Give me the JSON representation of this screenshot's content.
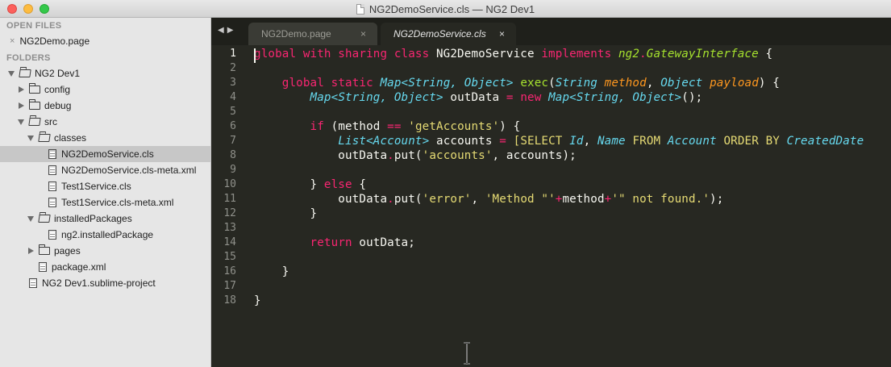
{
  "window": {
    "title": "NG2DemoService.cls — NG2 Dev1"
  },
  "sidebar": {
    "open_files_heading": "OPEN FILES",
    "open_files": [
      {
        "label": "NG2Demo.page",
        "close_symbol": "×"
      }
    ],
    "folders_heading": "FOLDERS",
    "tree": [
      {
        "label": "NG2 Dev1",
        "kind": "folder",
        "state": "open",
        "depth": 0
      },
      {
        "label": "config",
        "kind": "folder",
        "state": "closed",
        "depth": 1
      },
      {
        "label": "debug",
        "kind": "folder",
        "state": "closed",
        "depth": 1
      },
      {
        "label": "src",
        "kind": "folder",
        "state": "open",
        "depth": 1
      },
      {
        "label": "classes",
        "kind": "folder",
        "state": "open",
        "depth": 2
      },
      {
        "label": "NG2DemoService.cls",
        "kind": "file",
        "depth": 3,
        "selected": true
      },
      {
        "label": "NG2DemoService.cls-meta.xml",
        "kind": "file",
        "depth": 3
      },
      {
        "label": "Test1Service.cls",
        "kind": "file",
        "depth": 3
      },
      {
        "label": "Test1Service.cls-meta.xml",
        "kind": "file",
        "depth": 3
      },
      {
        "label": "installedPackages",
        "kind": "folder",
        "state": "open",
        "depth": 2
      },
      {
        "label": "ng2.installedPackage",
        "kind": "file",
        "depth": 3
      },
      {
        "label": "pages",
        "kind": "folder",
        "state": "closed",
        "depth": 2
      },
      {
        "label": "package.xml",
        "kind": "file",
        "depth": 2
      },
      {
        "label": "NG2 Dev1.sublime-project",
        "kind": "file",
        "depth": 1
      }
    ]
  },
  "tabs": {
    "nav_back": "◀",
    "nav_forward": "▶",
    "items": [
      {
        "label": "NG2Demo.page",
        "close_symbol": "×",
        "active": false
      },
      {
        "label": "NG2DemoService.cls",
        "close_symbol": "×",
        "active": true
      }
    ]
  },
  "editor": {
    "current_line": 1,
    "lines": [
      [
        [
          "kw",
          "global with sharing class "
        ],
        [
          "plain",
          "NG2DemoService "
        ],
        [
          "kw",
          "implements "
        ],
        [
          "iface",
          "ng2"
        ],
        [
          "kw",
          "."
        ],
        [
          "iface",
          "GatewayInterface"
        ],
        [
          "plain",
          " {"
        ]
      ],
      [],
      [
        [
          "plain",
          "    "
        ],
        [
          "kw",
          "global static "
        ],
        [
          "type",
          "Map<String, Object>"
        ],
        [
          "plain",
          " "
        ],
        [
          "fn",
          "exec"
        ],
        [
          "plain",
          "("
        ],
        [
          "type",
          "String"
        ],
        [
          "plain",
          " "
        ],
        [
          "param",
          "method"
        ],
        [
          "plain",
          ", "
        ],
        [
          "type",
          "Object"
        ],
        [
          "plain",
          " "
        ],
        [
          "param",
          "payload"
        ],
        [
          "plain",
          ") {"
        ]
      ],
      [
        [
          "plain",
          "        "
        ],
        [
          "type",
          "Map<String, Object>"
        ],
        [
          "plain",
          " outData "
        ],
        [
          "op",
          "="
        ],
        [
          "plain",
          " "
        ],
        [
          "kw",
          "new "
        ],
        [
          "type",
          "Map<String, Object>"
        ],
        [
          "plain",
          "();"
        ]
      ],
      [],
      [
        [
          "plain",
          "        "
        ],
        [
          "kw",
          "if"
        ],
        [
          "plain",
          " (method "
        ],
        [
          "op",
          "=="
        ],
        [
          "plain",
          " "
        ],
        [
          "str",
          "'getAccounts'"
        ],
        [
          "plain",
          ") {"
        ]
      ],
      [
        [
          "plain",
          "            "
        ],
        [
          "type",
          "List<Account>"
        ],
        [
          "plain",
          " accounts "
        ],
        [
          "op",
          "="
        ],
        [
          "plain",
          " "
        ],
        [
          "sql",
          "[SELECT "
        ],
        [
          "type",
          "Id"
        ],
        [
          "plain",
          ", "
        ],
        [
          "type",
          "Name"
        ],
        [
          "sql",
          " FROM "
        ],
        [
          "type",
          "Account"
        ],
        [
          "sql",
          " ORDER BY "
        ],
        [
          "type",
          "CreatedDate"
        ]
      ],
      [
        [
          "plain",
          "            outData"
        ],
        [
          "op",
          "."
        ],
        [
          "plain",
          "put("
        ],
        [
          "str",
          "'accounts'"
        ],
        [
          "plain",
          ", accounts);"
        ]
      ],
      [],
      [
        [
          "plain",
          "        } "
        ],
        [
          "kw",
          "else"
        ],
        [
          "plain",
          " {"
        ]
      ],
      [
        [
          "plain",
          "            outData"
        ],
        [
          "op",
          "."
        ],
        [
          "plain",
          "put("
        ],
        [
          "str",
          "'error'"
        ],
        [
          "plain",
          ", "
        ],
        [
          "str",
          "'Method \"'"
        ],
        [
          "op",
          "+"
        ],
        [
          "plain",
          "method"
        ],
        [
          "op",
          "+"
        ],
        [
          "str",
          "'\" not found.'"
        ],
        [
          "plain",
          ");"
        ]
      ],
      [
        [
          "plain",
          "        }"
        ]
      ],
      [],
      [
        [
          "plain",
          "        "
        ],
        [
          "kw",
          "return"
        ],
        [
          "plain",
          " outData;"
        ]
      ],
      [],
      [
        [
          "plain",
          "    }"
        ]
      ],
      [],
      [
        [
          "plain",
          "}"
        ]
      ]
    ],
    "line_numbers": [
      "1",
      "2",
      "3",
      "4",
      "5",
      "6",
      "7",
      "8",
      "9",
      "10",
      "11",
      "12",
      "13",
      "14",
      "15",
      "16",
      "17",
      "18"
    ]
  }
}
